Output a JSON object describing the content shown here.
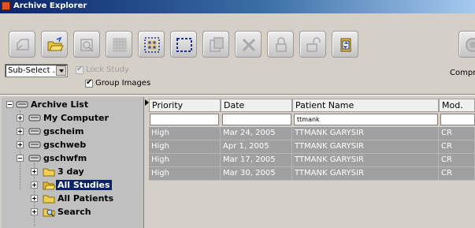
{
  "window": {
    "title": "Archive Explorer"
  },
  "toolbar": {
    "buttons": [
      {
        "icon": "new-study-icon",
        "enabled": false
      },
      {
        "icon": "open-folder-icon",
        "enabled": true
      },
      {
        "icon": "search-icon",
        "enabled": false
      },
      {
        "icon": "grid-icon",
        "enabled": false
      },
      {
        "icon": "select-all-icon",
        "enabled": true
      },
      {
        "icon": "select-none-icon",
        "enabled": true
      },
      {
        "icon": "copy-icon",
        "enabled": false
      },
      {
        "icon": "delete-icon",
        "enabled": false
      },
      {
        "icon": "lock-icon",
        "enabled": false
      },
      {
        "icon": "unlock-icon",
        "enabled": false
      },
      {
        "icon": "refresh-icon",
        "enabled": true
      },
      {
        "icon": "stop-icon",
        "enabled": false
      }
    ],
    "sub_select_value": "Sub-Select ...",
    "lock_study_label": "Lock Study",
    "lock_study_checked": true,
    "group_images_label": "Group Images",
    "group_images_checked": true,
    "compr_label": "Compr"
  },
  "tree": {
    "items": [
      {
        "label": "Archive List",
        "icon": "archive-icon",
        "expanded": true
      },
      {
        "label": "My Computer",
        "icon": "drive-icon",
        "expanded": false
      },
      {
        "label": "gscheim",
        "icon": "drive-icon",
        "expanded": false
      },
      {
        "label": "gschweb",
        "icon": "drive-icon",
        "expanded": false
      },
      {
        "label": "gschwfm",
        "icon": "drive-icon",
        "expanded": true
      },
      {
        "label": "3 day",
        "icon": "folder-icon",
        "expanded": false
      },
      {
        "label": "All Studies",
        "icon": "folder-open-icon",
        "expanded": false,
        "selected": true
      },
      {
        "label": "All Patients",
        "icon": "folder-icon",
        "expanded": false
      },
      {
        "label": "Search",
        "icon": "search-folder-icon",
        "expanded": false
      }
    ]
  },
  "table": {
    "columns": [
      "Priority",
      "Date",
      "Patient Name",
      "Mod."
    ],
    "filter": [
      "",
      "",
      "ttmank",
      ""
    ],
    "rows": [
      [
        "High",
        "Mar 24, 2005",
        "TTMANK GARYSIR",
        "CR"
      ],
      [
        "High",
        "Apr 1, 2005",
        "TTMANK GARYSIR",
        "CR"
      ],
      [
        "High",
        "Mar 17, 2005",
        "TTMANK GARYSIR",
        "CR"
      ],
      [
        "High",
        "Mar 30, 2005",
        "TTMANK GARYSIR",
        "CR"
      ]
    ]
  },
  "colors": {
    "title_bar": "#0a246a",
    "selection": "#0a246a",
    "row_bg": "#a0a0a0"
  }
}
